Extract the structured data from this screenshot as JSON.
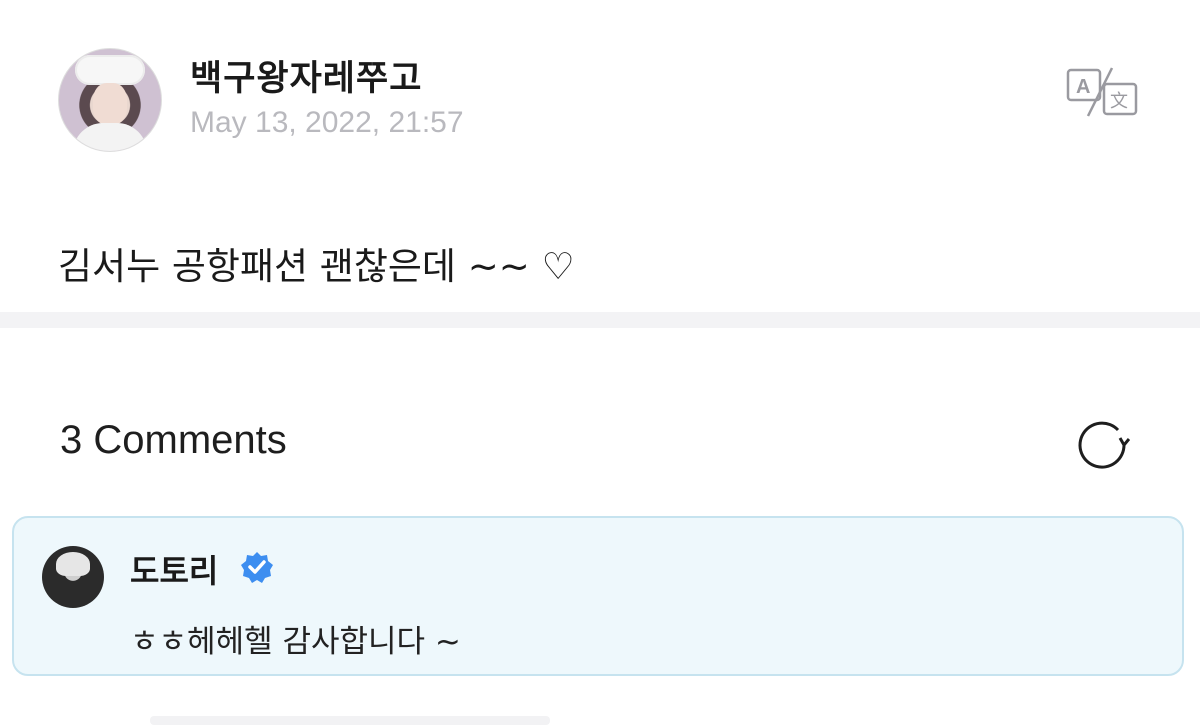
{
  "post": {
    "author": "백구왕자레쭈고",
    "date": "May 13, 2022, 21:57",
    "body": "김서누 공항패션 괜찮은데 ~~ ♡",
    "avatar_icon": "user-avatar"
  },
  "comments": {
    "title": "3 Comments",
    "items": [
      {
        "name": "도토리",
        "verified": true,
        "text": "ㅎㅎ헤헤헬 감사합니다 ~"
      }
    ]
  },
  "icons": {
    "translate": "translate-icon",
    "refresh": "refresh-icon",
    "verified": "verified-badge-icon"
  },
  "colors": {
    "card_bg": "#eef8fc",
    "card_border": "#c6e3ef",
    "verified": "#3d8ef0",
    "date_text": "#b9b9be"
  }
}
